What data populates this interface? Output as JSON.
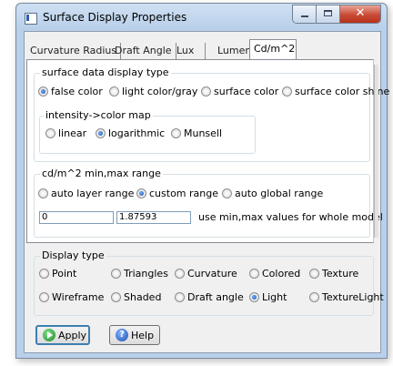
{
  "window": {
    "title": "Surface Display Properties"
  },
  "tabs": [
    "Curvature Radius",
    "Draft Angle",
    "Lux",
    "Lumen",
    "Cd/m^2"
  ],
  "active_tab": "Cd/m^2",
  "surface_display_type": {
    "label": "surface data display type",
    "options": [
      "false color",
      "light color/gray",
      "surface color",
      "surface color shine"
    ],
    "selected": "false color"
  },
  "intensity_map": {
    "label": "intensity->color map",
    "options": [
      "linear",
      "logarithmic",
      "Munsell"
    ],
    "selected": "logarithmic"
  },
  "range": {
    "label": "cd/m^2 min,max range",
    "options": [
      "auto layer range",
      "custom range",
      "auto global range"
    ],
    "selected": "custom range",
    "min": "0",
    "max": "1.87593",
    "whole_model_label": "use min,max values for whole model"
  },
  "display_type": {
    "label": "Display type",
    "options": [
      "Point",
      "Triangles",
      "Curvature",
      "Colored",
      "Texture",
      "Wireframe",
      "Shaded",
      "Draft angle",
      "Light",
      "TextureLight"
    ],
    "selected": "Light"
  },
  "buttons": {
    "apply": "Apply",
    "help": "Help"
  },
  "icons": {
    "app": "app-icon",
    "minimize": "minimize-icon",
    "maximize": "maximize-icon",
    "close": "close-icon",
    "close_glyph": "✕",
    "apply": "play-circle-icon",
    "help": "help-circle-icon",
    "help_glyph": "?"
  },
  "colors": {
    "accent": "#1c4fb0",
    "title_bar": "#b9d0ea",
    "close": "#c94a35",
    "apply": "#1c8a2c"
  }
}
